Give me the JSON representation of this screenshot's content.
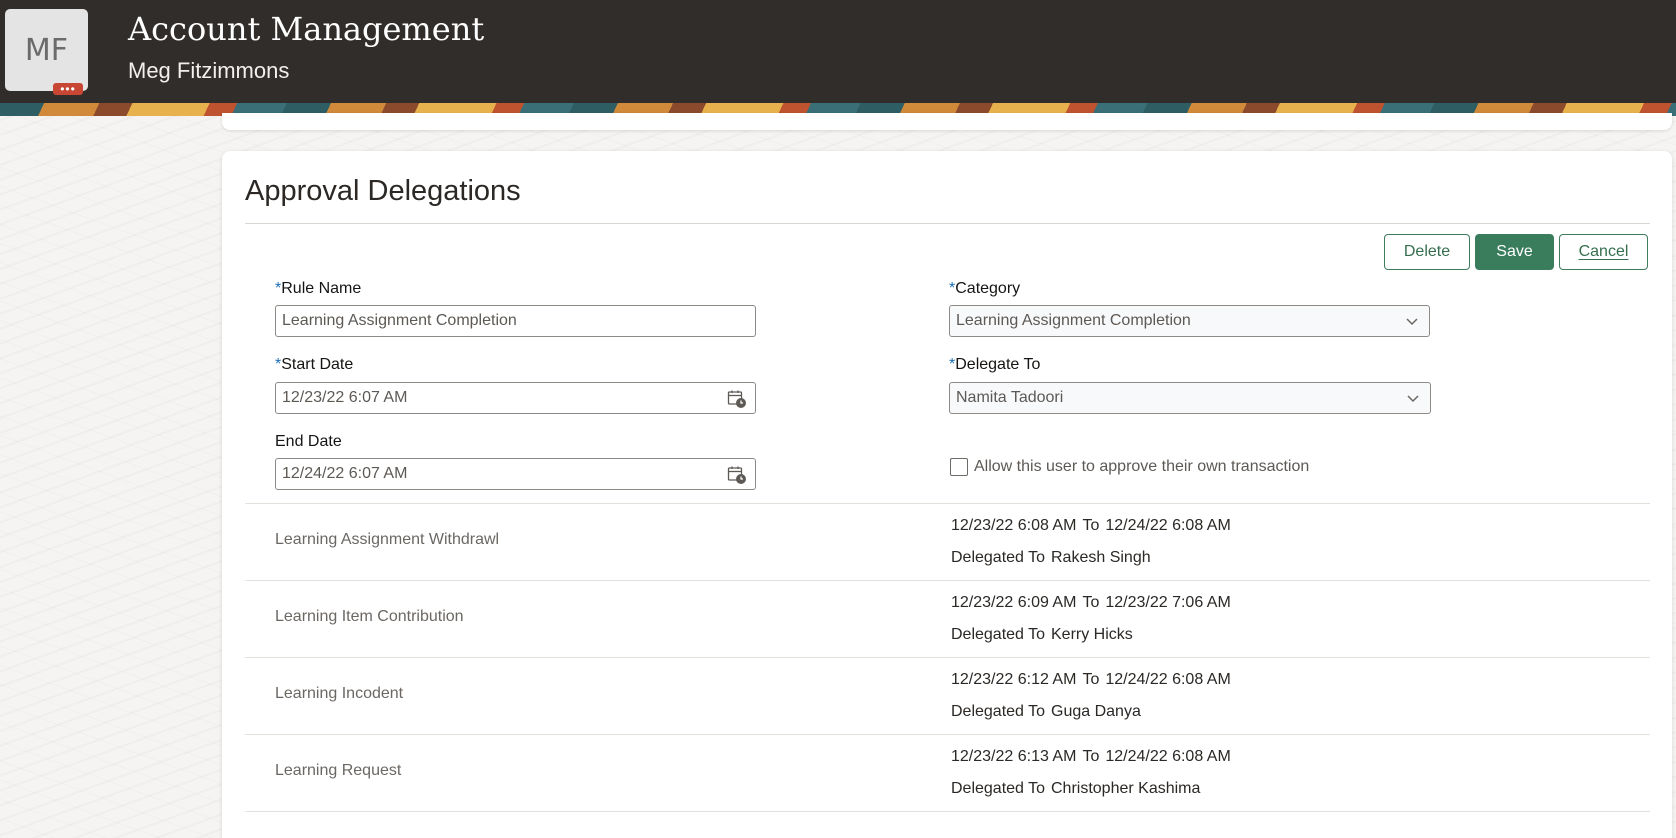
{
  "header": {
    "avatar_initials": "MF",
    "avatar_badge": "•••",
    "title": "Account Management",
    "user_name": "Meg Fitzimmons"
  },
  "section": {
    "title": "Approval Delegations"
  },
  "toolbar": {
    "delete_label": "Delete",
    "save_label": "Save",
    "cancel_label": "Cancel"
  },
  "form": {
    "required_mark": "*",
    "rule_name_label": "Rule Name",
    "rule_name_value": "Learning Assignment Completion",
    "category_label": "Category",
    "category_value": "Learning Assignment Completion",
    "start_date_label": "Start Date",
    "start_date_value": "12/23/22 6:07 AM",
    "delegate_to_label": "Delegate To",
    "delegate_to_value": "Namita Tadoori",
    "end_date_label": "End Date",
    "end_date_value": "12/24/22 6:07 AM",
    "self_approve_label": "Allow this user to approve their own transaction",
    "self_approve_checked": false
  },
  "rules": [
    {
      "name": "Learning Assignment Withdrawl",
      "start": "12/23/22 6:08 AM",
      "to_word": "To",
      "end": "12/24/22 6:08 AM",
      "delegated_label": "Delegated To",
      "delegate": "Rakesh Singh"
    },
    {
      "name": "Learning Item Contribution",
      "start": "12/23/22 6:09 AM",
      "to_word": "To",
      "end": "12/23/22 7:06 AM",
      "delegated_label": "Delegated To",
      "delegate": "Kerry Hicks"
    },
    {
      "name": "Learning Incodent",
      "start": "12/23/22 6:12 AM",
      "to_word": "To",
      "end": "12/24/22 6:08 AM",
      "delegated_label": "Delegated To",
      "delegate": "Guga Danya"
    },
    {
      "name": "Learning Request",
      "start": "12/23/22 6:13 AM",
      "to_word": "To",
      "end": "12/24/22 6:08 AM",
      "delegated_label": "Delegated To",
      "delegate": "Christopher Kashima"
    }
  ],
  "icons": {
    "calendar": "calendar-icon",
    "chevron": "chevron-down-icon"
  },
  "colors": {
    "header_bg": "#312d2a",
    "primary_button": "#3a7d5c",
    "required_mark": "#1c6fb5",
    "avatar_badge": "#c74634"
  }
}
